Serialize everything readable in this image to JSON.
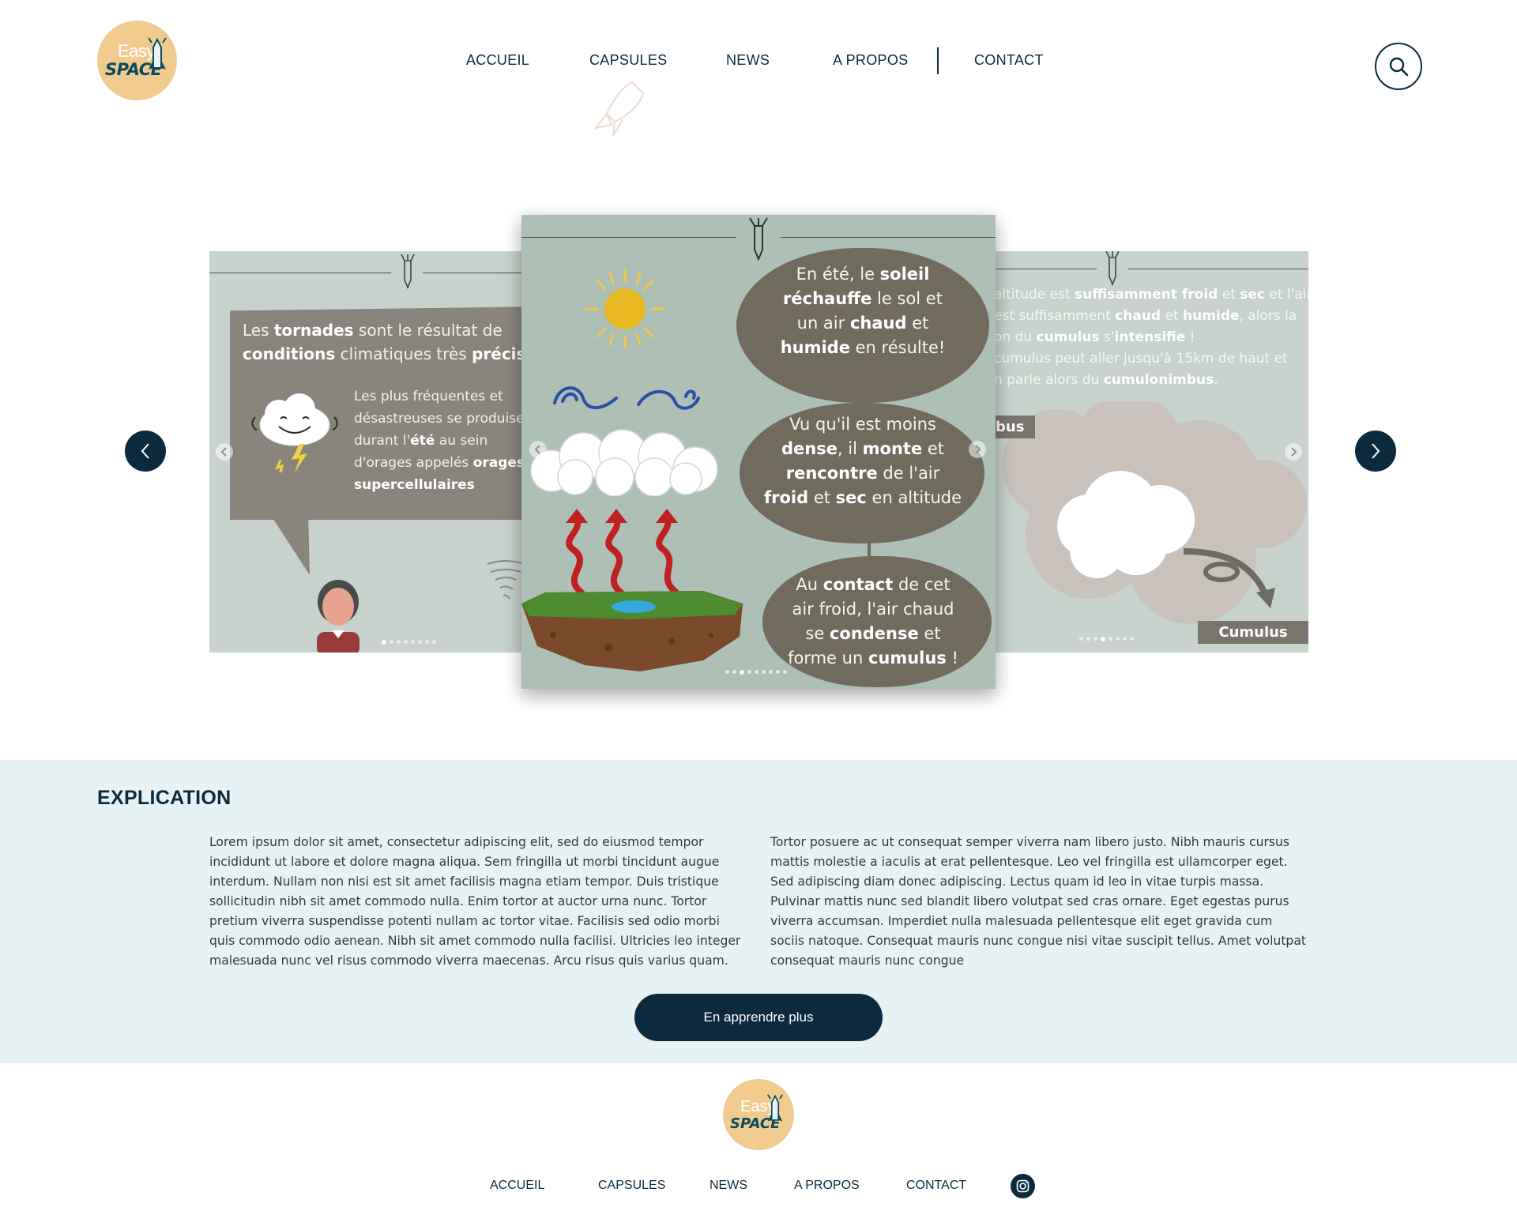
{
  "brand": {
    "logo_line1": "Easy",
    "logo_line2": "SPACE",
    "colors": {
      "navy": "#0b2a3d",
      "logo_bg": "#f1cb8e",
      "section_bg": "#e7f2f4",
      "slide_bg": "#aebfb6"
    }
  },
  "nav": {
    "items": [
      "ACCUEIL",
      "CAPSULES",
      "NEWS",
      "A PROPOS",
      "CONTACT"
    ],
    "search_icon": "search-icon"
  },
  "carousel": {
    "prev_icon": "chevron-left-icon",
    "next_icon": "chevron-right-icon",
    "left_slide": {
      "heading_pre": "Les ",
      "heading_b1": "tornades",
      "heading_mid": " sont le résultat de",
      "heading_b2": "conditions",
      "heading_post": " climatiques très ",
      "heading_b3": "précises",
      "body_1": "Les plus fréquentes et désastreuses se produisent durant l'",
      "body_b1": "été",
      "body_2": " au sein d'orages appelés ",
      "body_b2": "orages supercellulaires"
    },
    "center_slide": {
      "bubble1": {
        "p1": "En été, le ",
        "b1": "soleil",
        "b2": "réchauffe",
        "p2": " le sol et",
        "p3": "un air ",
        "b3": "chaud",
        "p4": " et",
        "b4": "humide",
        "p5": " en résulte!"
      },
      "bubble2": {
        "p1": "Vu qu'il est moins",
        "b1": "dense",
        "p2": ", il ",
        "b2": "monte",
        "p3": " et",
        "b3": "rencontre",
        "p4": " de l'air",
        "b4": "froid",
        "p5": " et ",
        "b5": "sec",
        "p6": " en altitude"
      },
      "bubble3": {
        "p1": "Au ",
        "b1": "contact",
        "p2": " de cet",
        "p3": "air froid, l'air chaud",
        "p4": "se ",
        "b2": "condense",
        "p5": " et",
        "p6": "forme un ",
        "b3": "cumulus",
        "p7": " !"
      }
    },
    "right_slide": {
      "line1_pre": "altitude est ",
      "line1_b1": "suffisamment froid",
      "line1_mid": " et ",
      "line1_b2": "sec",
      "line1_post": " et l'air",
      "line2_pre": "est suffisamment ",
      "line2_b1": "chaud",
      "line2_mid": " et ",
      "line2_b2": "humide",
      "line2_post": ", alors la",
      "line3_pre": "on du ",
      "line3_b1": "cumulus",
      "line3_mid": " s'",
      "line3_b2": "intensifie",
      "line3_post": " !",
      "line4": "cumulus peut aller jusqu'à 15km de haut et",
      "line5_pre": "n parle alors du ",
      "line5_b1": "cumulonimbus",
      "line5_post": ".",
      "tag_top": "bus",
      "tag_bottom": "Cumulus"
    }
  },
  "explication": {
    "title": "EXPLICATION",
    "para_left": "Lorem ipsum dolor sit amet, consectetur adipiscing elit, sed do eiusmod tempor incididunt ut labore et dolore magna aliqua. Sem fringilla ut morbi tincidunt augue interdum. Nullam non nisi est sit amet facilisis magna etiam tempor. Duis tristique sollicitudin nibh sit amet commodo nulla. Enim tortor at auctor urna nunc. Tortor pretium viverra suspendisse potenti nullam ac tortor vitae. Facilisis sed odio morbi quis commodo odio aenean. Nibh sit amet commodo nulla facilisi. Ultricies leo integer malesuada nunc vel risus commodo viverra maecenas. Arcu risus quis varius quam.",
    "para_right": "Tortor posuere ac ut consequat semper viverra nam libero justo. Nibh mauris cursus mattis molestie a iaculis at erat pellentesque. Leo vel fringilla est ullamcorper eget. Sed adipiscing diam donec adipiscing. Lectus quam id leo in vitae turpis massa. Pulvinar mattis nunc sed blandit libero volutpat sed cras ornare. Eget egestas purus viverra accumsan. Imperdiet nulla malesuada pellentesque elit eget gravida cum sociis natoque. Consequat mauris nunc congue nisi vitae suscipit tellus. Amet volutpat consequat mauris nunc congue",
    "cta_label": "En apprendre plus"
  },
  "footer": {
    "logo_line1": "Easy",
    "logo_line2": "SPACE",
    "nav": [
      "ACCUEIL",
      "CAPSULES",
      "NEWS",
      "A PROPOS",
      "CONTACT"
    ],
    "social_icon": "instagram-icon"
  }
}
